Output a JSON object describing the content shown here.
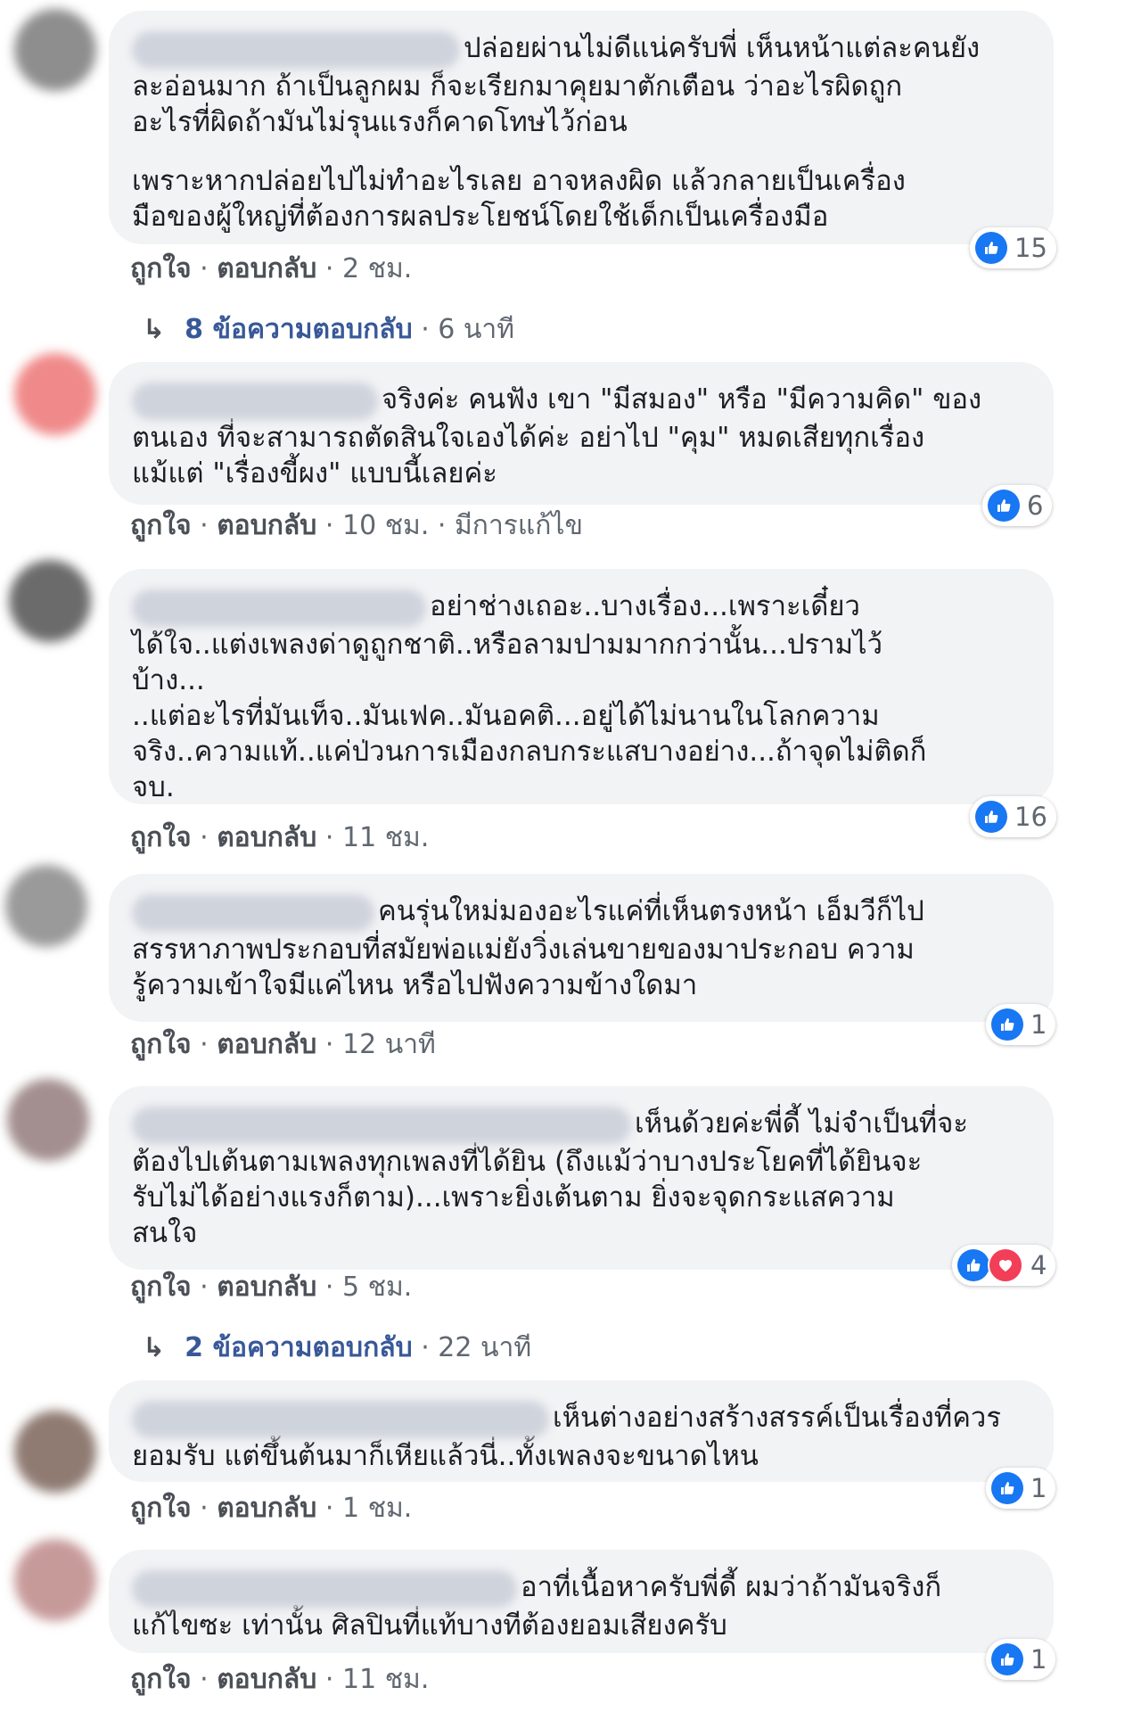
{
  "comments": [
    {
      "text": "ปล่อยผ่านไม่ดีแน่ครับพี่ เห็นหน้าแต่ละคนยัง\nละอ่อนมาก ถ้าเป็นลูกผม ก็จะเรียกมาคุยมาตักเตือน ว่าอะไรผิดถูก\nอะไรที่ผิดถ้ามันไม่รุนแรงก็คาดโทษไว้ก่อน",
      "text2": "เพราะหากปล่อยไปไม่ทำอะไรเลย อาจหลงผิด แล้วกลายเป็นเครื่อง\nมือของผู้ใหญ่ที่ต้องการผลประโยชน์โดยใช้เด็กเป็นเครื่องมือ",
      "like_label": "ถูกใจ",
      "reply_label": "ตอบกลับ",
      "time": "2 ชม.",
      "reactions": "15"
    },
    {
      "text": "จริงค่ะ คนฟัง เขา \"มีสมอง\" หรือ \"มีความคิด\" ของ\nตนเอง ที่จะสามารถตัดสินใจเองได้ค่ะ อย่าไป \"คุม\" หมดเสียทุกเรื่อง\nแม้แต่ \"เรื่องขี้ผง\" แบบนี้เลยค่ะ",
      "like_label": "ถูกใจ",
      "reply_label": "ตอบกลับ",
      "time": "10 ชม.",
      "edited": "มีการแก้ไข",
      "reactions": "6"
    },
    {
      "text": "อย่าช่างเถอะ..บางเรื่อง...เพราะเดี๋ยว\nได้ใจ..แต่งเพลงด่าดูถูกชาติ..หรือลามปามมากกว่านั้น...ปรามไว้\nบ้าง...\n..แต่อะไรที่มันเท็จ..มันเฟค..มันอคติ...อยู่ได้ไม่นานในโลกความ\nจริง..ความแท้..แค่ป่วนการเมืองกลบกระแสบางอย่าง...ถ้าจุดไม่ติดก็\nจบ.",
      "like_label": "ถูกใจ",
      "reply_label": "ตอบกลับ",
      "time": "11 ชม.",
      "reactions": "16"
    },
    {
      "text": "คนรุ่นใหม่มองอะไรแค่ที่เห็นตรงหน้า เอ็มวีก็ไป\nสรรหาภาพประกอบที่สมัยพ่อแม่ยังวิ่งเล่นขายของมาประกอบ ความ\nรู้ความเข้าใจมีแค่ไหน หรือไปฟังความข้างใดมา",
      "like_label": "ถูกใจ",
      "reply_label": "ตอบกลับ",
      "time": "12 นาที",
      "reactions": "1"
    },
    {
      "text": "เห็นด้วยค่ะพี่ดี้ ไม่จำเป็นที่จะ\nต้องไปเต้นตามเพลงทุกเพลงที่ได้ยิน (ถึงแม้ว่าบางประโยคที่ได้ยินจะ\nรับไม่ได้อย่างแรงก็ตาม)...เพราะยิ่งเต้นตาม ยิ่งจะจุดกระแสความ\nสนใจ",
      "like_label": "ถูกใจ",
      "reply_label": "ตอบกลับ",
      "time": "5 ชม.",
      "reactions": "4"
    },
    {
      "text": "เห็นต่างอย่างสร้างสรรค์เป็นเรื่องที่ควร\nยอมรับ แต่ขึ้นต้นมาก็เหียแล้วนี่..ทั้งเพลงจะขนาดไหน",
      "like_label": "ถูกใจ",
      "reply_label": "ตอบกลับ",
      "time": "1 ชม.",
      "reactions": "1"
    },
    {
      "text": "อาที่เนื้อหาครับพี่ดี้ ผมว่าถ้ามันจริงก็\nแก้ไขซะ เท่านั้น ศิลปินที่แท้บางทีต้องยอมเสียงครับ",
      "like_label": "ถูกใจ",
      "reply_label": "ตอบกลับ",
      "time": "11 ชม.",
      "reactions": "1"
    }
  ],
  "replies": [
    {
      "count_text": "8 ข้อความตอบกลับ",
      "time": "6 นาที"
    },
    {
      "count_text": "2 ข้อความตอบกลับ",
      "time": "22 นาที"
    }
  ],
  "separator": "·",
  "colors": {
    "like": "#1877f2",
    "love": "#f33e58",
    "bubble": "#f2f3f5",
    "link": "#385898"
  }
}
